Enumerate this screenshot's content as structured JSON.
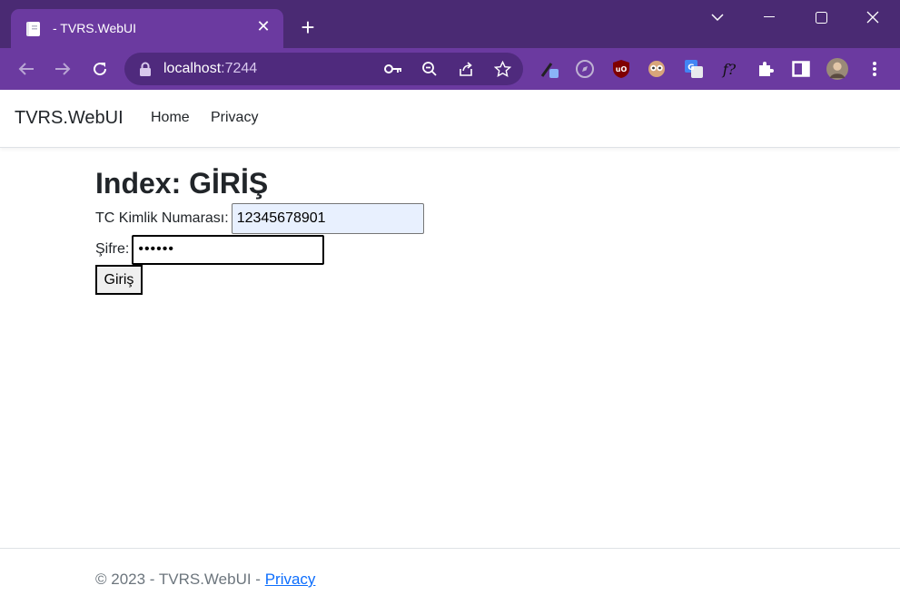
{
  "browser": {
    "tab_title": "- TVRS.WebUI",
    "url_host": "localhost",
    "url_port": ":7244"
  },
  "navbar": {
    "brand": "TVRS.WebUI",
    "links": [
      "Home",
      "Privacy"
    ]
  },
  "main": {
    "heading": "Index: GİRİŞ",
    "tc_label": "TC Kimlik Numarası:",
    "tc_value": "12345678901",
    "password_label": "Şifre:",
    "password_value": "••••••",
    "submit_label": "Giriş"
  },
  "footer": {
    "text": "© 2023 - TVRS.WebUI - ",
    "link": "Privacy"
  },
  "colors": {
    "titlebar": "#4a2a73",
    "toolbar": "#6b3aa0",
    "link": "#0d6efd"
  }
}
